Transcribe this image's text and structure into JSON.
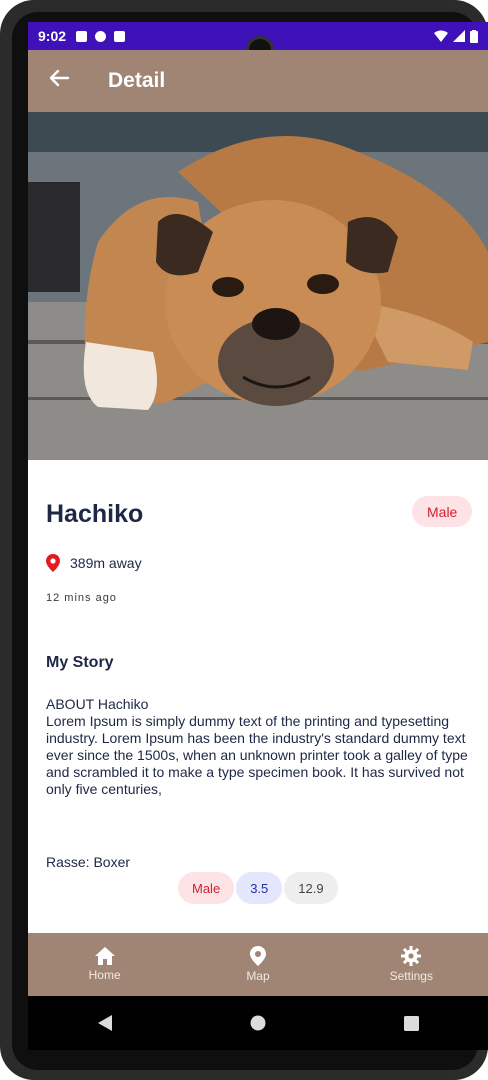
{
  "status_bar": {
    "time": "9:02",
    "bg_color": "#3f11b8"
  },
  "app_bar": {
    "title": "Detail",
    "back_icon": "arrow-back-icon",
    "bg_color": "#a08575"
  },
  "pet": {
    "name": "Hachiko",
    "gender_badge": "Male",
    "distance": "389m away",
    "time_ago": "12 mins ago",
    "story_title": "My Story",
    "story_heading": "ABOUT Hachiko",
    "story_text": "Lorem Ipsum is simply dummy text of the printing and typesetting industry. Lorem Ipsum has been the industry's standard dummy text ever since the 1500s, when an unknown printer took a galley of type and scrambled it to make a type specimen book. It has survived not only five centuries,",
    "breed": "Rasse: Boxer",
    "chips": {
      "gender": "Male",
      "age": "3.5",
      "weight": "12.9"
    }
  },
  "bottom_nav": {
    "items": [
      {
        "label": "Home",
        "icon": "home-icon"
      },
      {
        "label": "Map",
        "icon": "map-pin-icon"
      },
      {
        "label": "Settings",
        "icon": "gear-icon"
      }
    ]
  },
  "system_nav": {
    "back": "back-triangle-icon",
    "home": "home-circle-icon",
    "recents": "recents-square-icon"
  },
  "colors": {
    "accent_brown": "#a08575",
    "badge_red": "#d21f2e",
    "badge_red_bg": "#fde3e6",
    "chip_blue": "#2230a8",
    "text_navy": "#1e2846"
  }
}
